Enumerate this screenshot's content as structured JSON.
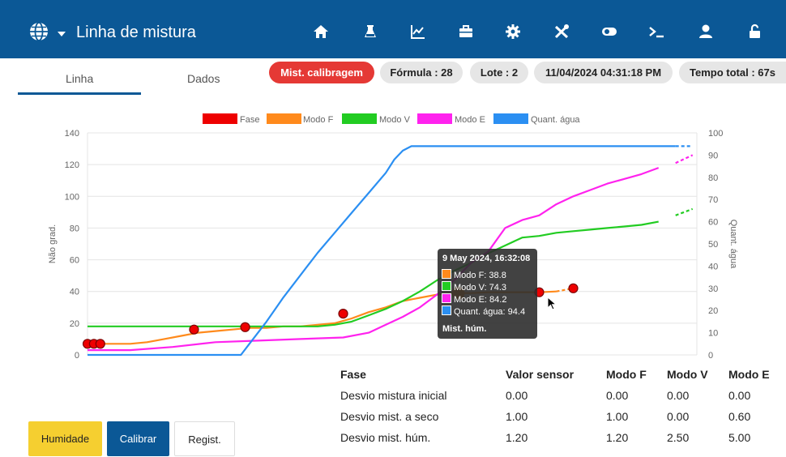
{
  "header": {
    "title": "Linha de mistura",
    "icons": [
      "globe-icon",
      "home-icon",
      "flask-icon",
      "chart-icon",
      "toolbox-icon",
      "settings-icon",
      "tools-icon",
      "toggle-icon",
      "terminal-icon",
      "user-icon",
      "lock-icon"
    ]
  },
  "tabs": [
    {
      "label": "Linha"
    },
    {
      "label": "Dados"
    }
  ],
  "status": {
    "mode": "Mist. calibragem",
    "formula": "Fórmula : 28",
    "lote": "Lote : 2",
    "datetime": "11/04/2024 04:31:18 PM",
    "tempo": "Tempo total : 67s"
  },
  "colors": {
    "accent": "#0b5896",
    "fase": "#ee0000",
    "modo_f": "#ff8a1c",
    "modo_v": "#22cc22",
    "modo_e": "#ff22ee",
    "agua": "#2b8ff2"
  },
  "chart_data": {
    "type": "line",
    "ylabel": "Não grad.",
    "y2label": "Quant. água",
    "ylim": [
      0,
      140
    ],
    "y2lim": [
      0,
      100
    ],
    "yticks": [
      0,
      20,
      40,
      60,
      80,
      100,
      120,
      140
    ],
    "y2ticks": [
      0,
      10,
      20,
      30,
      40,
      50,
      60,
      70,
      80,
      90,
      100
    ],
    "legend": [
      "Fase",
      "Modo F",
      "Modo V",
      "Modo E",
      "Quant. água"
    ],
    "legend_position": "top",
    "grid": true,
    "series": [
      {
        "name": "Modo F",
        "axis": "left",
        "values": [
          [
            0,
            7
          ],
          [
            10,
            7
          ],
          [
            14,
            8
          ],
          [
            18,
            10
          ],
          [
            22,
            12
          ],
          [
            26,
            14
          ],
          [
            30,
            15
          ],
          [
            34,
            16
          ],
          [
            38,
            17
          ],
          [
            42,
            17
          ],
          [
            46,
            18
          ],
          [
            50,
            18
          ],
          [
            54,
            19
          ],
          [
            58,
            20
          ],
          [
            62,
            23
          ],
          [
            66,
            27
          ],
          [
            70,
            30
          ],
          [
            74,
            34
          ],
          [
            78,
            36
          ],
          [
            82,
            38
          ],
          [
            86,
            39
          ],
          [
            90,
            39
          ],
          [
            94,
            39.5
          ],
          [
            98,
            39.5
          ],
          [
            102,
            39.5
          ],
          [
            106,
            39.5
          ],
          [
            110,
            40
          ],
          [
            114,
            42
          ]
        ],
        "dashed_from": 110
      },
      {
        "name": "Modo V",
        "axis": "left",
        "values": [
          [
            0,
            18
          ],
          [
            50,
            18
          ],
          [
            54,
            18
          ],
          [
            58,
            19
          ],
          [
            62,
            21
          ],
          [
            66,
            25
          ],
          [
            70,
            29
          ],
          [
            74,
            34
          ],
          [
            78,
            40
          ],
          [
            82,
            47
          ],
          [
            86,
            53
          ],
          [
            90,
            58
          ],
          [
            94,
            64
          ],
          [
            98,
            69
          ],
          [
            102,
            74
          ],
          [
            106,
            75
          ],
          [
            110,
            77
          ],
          [
            114,
            78
          ],
          [
            118,
            79
          ],
          [
            122,
            80
          ],
          [
            126,
            81
          ],
          [
            130,
            82
          ],
          [
            134,
            84
          ],
          [
            138,
            88
          ],
          [
            142,
            92
          ]
        ],
        "dashed_from": 137
      },
      {
        "name": "Modo E",
        "axis": "left",
        "values": [
          [
            0,
            3
          ],
          [
            10,
            3
          ],
          [
            20,
            5
          ],
          [
            30,
            8
          ],
          [
            40,
            9
          ],
          [
            50,
            10
          ],
          [
            60,
            11
          ],
          [
            66,
            14
          ],
          [
            70,
            19
          ],
          [
            74,
            24
          ],
          [
            78,
            30
          ],
          [
            82,
            38
          ],
          [
            86,
            47
          ],
          [
            90,
            58
          ],
          [
            94,
            65
          ],
          [
            98,
            80
          ],
          [
            102,
            85
          ],
          [
            106,
            88
          ],
          [
            110,
            95
          ],
          [
            114,
            100
          ],
          [
            118,
            104
          ],
          [
            122,
            108
          ],
          [
            126,
            111
          ],
          [
            130,
            114
          ],
          [
            134,
            118
          ],
          [
            138,
            121
          ],
          [
            142,
            126
          ]
        ],
        "dashed_from": 137
      },
      {
        "name": "Quant. água",
        "axis": "right",
        "values": [
          [
            0,
            0
          ],
          [
            36,
            0
          ],
          [
            38,
            5
          ],
          [
            42,
            15
          ],
          [
            46,
            26
          ],
          [
            50,
            36
          ],
          [
            54,
            46
          ],
          [
            58,
            55
          ],
          [
            62,
            64
          ],
          [
            66,
            73
          ],
          [
            70,
            82
          ],
          [
            72,
            88
          ],
          [
            74,
            92
          ],
          [
            76,
            94
          ],
          [
            80,
            94
          ],
          [
            100,
            94
          ],
          [
            120,
            94
          ],
          [
            138,
            94
          ],
          [
            142,
            94
          ]
        ],
        "dashed_from": 138
      }
    ],
    "fase_markers": [
      [
        0,
        7
      ],
      [
        1.5,
        7
      ],
      [
        3,
        7
      ],
      [
        25,
        16
      ],
      [
        37,
        17.5
      ],
      [
        60,
        26
      ],
      [
        106,
        39.5
      ],
      [
        114,
        42
      ]
    ],
    "hover_point": [
      87,
      39
    ],
    "tooltip": {
      "title": "9 May 2024, 16:32:08",
      "items": [
        {
          "label": "Modo F: 38.8",
          "color": "#ff8a1c"
        },
        {
          "label": "Modo V: 74.3",
          "color": "#22cc22"
        },
        {
          "label": "Modo E: 84.2",
          "color": "#ff22ee"
        },
        {
          "label": "Quant. água: 94.4",
          "color": "#2b8ff2"
        }
      ],
      "footer": "Mist. húm."
    }
  },
  "fase_table": {
    "headers": [
      "Fase",
      "Valor sensor",
      "Modo F",
      "Modo V",
      "Modo E"
    ],
    "rows": [
      [
        "Desvio mistura inicial",
        "0.00",
        "0.00",
        "0.00",
        "0.00"
      ],
      [
        "Desvio mist. a seco",
        "1.00",
        "1.00",
        "0.00",
        "0.60"
      ],
      [
        "Desvio mist. húm.",
        "1.20",
        "1.20",
        "2.50",
        "5.00"
      ]
    ]
  },
  "buttons": {
    "humidade": "Humidade",
    "calibrar": "Calibrar",
    "regist": "Regist."
  }
}
